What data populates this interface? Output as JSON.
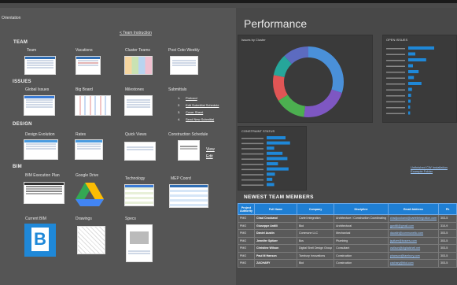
{
  "left": {
    "top_title": "Orientation",
    "back_link": "< Team Instruction",
    "sections": [
      {
        "name": "TEAM"
      },
      {
        "name": "ISSUES"
      },
      {
        "name": "DESIGN"
      },
      {
        "name": "BIM"
      }
    ],
    "items": {
      "team": "Team",
      "vacations": "Vacations",
      "cluster_teams": "Cluster Teams",
      "post_coto": "Post Coto Weekly",
      "global_issues": "Global Issues",
      "big_board": "Big Board",
      "milestones": "Milestones",
      "submittals": "Submittals",
      "design_evolution": "Design Evolution",
      "rates": "Rates",
      "quick_views": "Quick Views",
      "construction_schedule": "Construction Schedule",
      "bim_execution_plan": "BIM Execution Plan",
      "google_drive": "Google Drive",
      "technology": "Technology",
      "mep_coord": "MEP Coord",
      "current_bim": "Current BIM",
      "drawings": "Drawings",
      "specs": "Specs"
    },
    "submittal_links": [
      {
        "n": "1.",
        "label": "Protocol"
      },
      {
        "n": "2.",
        "label": "Edit Submittal Schedule"
      },
      {
        "n": "3.",
        "label": "Cover Sheet"
      },
      {
        "n": "4.",
        "label": "Send New Submittal"
      }
    ],
    "schedule_links": {
      "view": "View",
      "edit": "Edit"
    }
  },
  "right": {
    "title": "Performance",
    "panels": {
      "issues_by_cluster": "Issues by Cluster",
      "open_issues": "OPEN ISSUES",
      "constraint_status": "CONSTRAINT STATUS"
    },
    "donut_segments": [
      {
        "color": "#4a90d9",
        "value": 30
      },
      {
        "color": "#7e57c2",
        "value": 22
      },
      {
        "color": "#4caf50",
        "value": 14
      },
      {
        "color": "#e05555",
        "value": 12
      },
      {
        "color": "#26a69a",
        "value": 10
      },
      {
        "color": "#5c6bc0",
        "value": 12
      }
    ],
    "open_issues_bars": [
      0.55,
      0.15,
      0.38,
      0.1,
      0.22,
      0.12,
      0.28,
      0.08,
      0.06,
      0.05,
      0.04,
      0.04
    ],
    "constraint_bars": [
      0.5,
      0.62,
      0.2,
      0.42,
      0.55,
      0.3,
      0.58,
      0.22,
      0.15,
      0.2
    ],
    "unfinished_link": "Unfinished CW Installation Example Folder",
    "members_title": "NEWEST TEAM MEMBERS",
    "members_columns": [
      "Project Authority",
      "Full Name",
      "Company",
      "Discipline",
      "Email Address",
      "Ph"
    ],
    "members": [
      {
        "auth": "PMO",
        "name": "Chad Crookand",
        "company": "Cartel Integration",
        "discipline": "Architecture / Construction Coordinating",
        "email": "chadjcookand@cartelintegration.com",
        "phone": "303-5"
      },
      {
        "auth": "PMO",
        "name": "Giuseppe Antilli",
        "company": "Bkd",
        "discipline": "Architectural",
        "email": "gantilli@gmail.com",
        "phone": "310-9"
      },
      {
        "auth": "PMO",
        "name": "Daniel Austin",
        "company": "Commune LLC",
        "discipline": "Mechanical",
        "email": "daustin@communellc.com",
        "phone": "303-5"
      },
      {
        "auth": "PMO",
        "name": "Jennifer Spitzer",
        "company": "Bcs",
        "discipline": "Plumbing",
        "email": "jspitzer@bcsenv.com",
        "phone": "303-5"
      },
      {
        "auth": "PMO",
        "name": "Christine Wilson",
        "company": "Digital Shell Design Group",
        "discipline": "Consultant",
        "email": "cwilson@digitalshell.net",
        "phone": "303-5"
      },
      {
        "auth": "PMO",
        "name": "Paul M Hanson",
        "company": "Tambury Innovations",
        "discipline": "Construction",
        "email": "phanson@tambury.com",
        "phone": "303-5"
      },
      {
        "auth": "PMO",
        "name": "ZACHARY",
        "company": "Bkd",
        "discipline": "Construction",
        "email": "zachary@bkd.com",
        "phone": "303-5"
      }
    ]
  }
}
